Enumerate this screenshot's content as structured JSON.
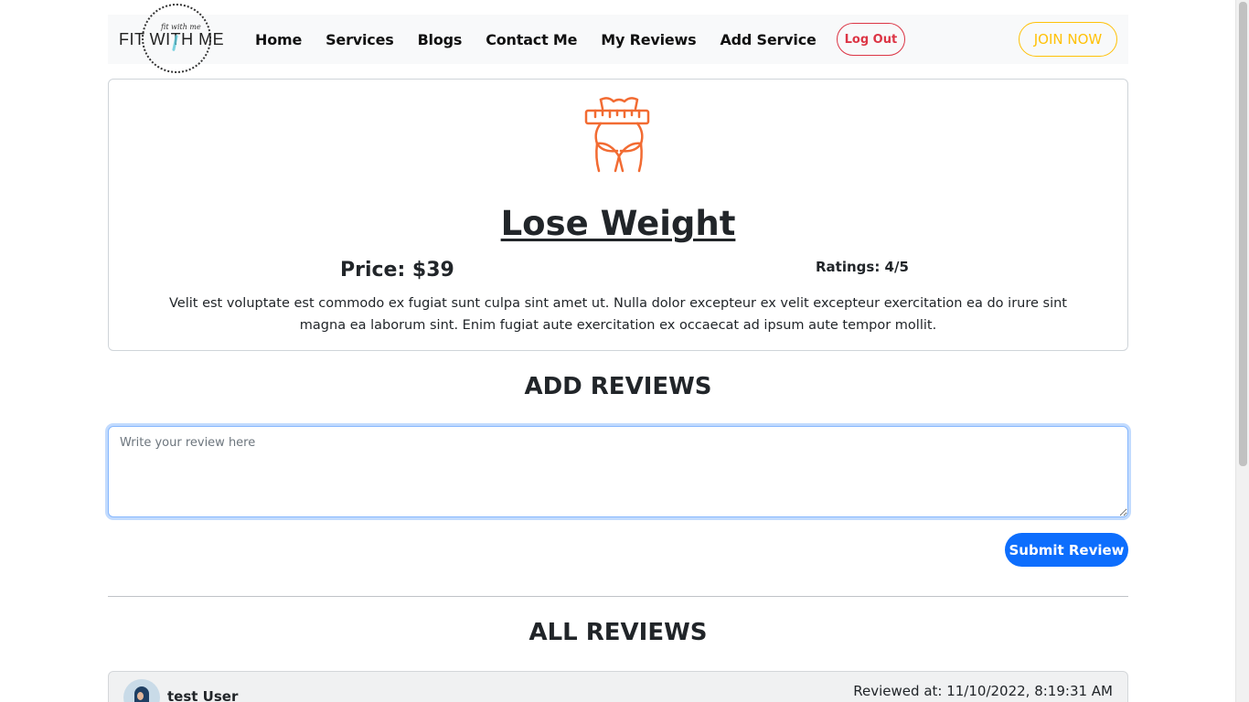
{
  "navbar": {
    "logo_small": "fit with me",
    "logo_text": "FIT WITH ME",
    "links": [
      "Home",
      "Services",
      "Blogs",
      "Contact Me",
      "My Reviews",
      "Add Service"
    ],
    "logout_label": "Log Out",
    "join_label": "JOIN NOW"
  },
  "service": {
    "icon": "weight-loss-icon",
    "icon_color": "#f26b32",
    "title": "Lose Weight",
    "price": "Price: $39",
    "ratings": "Ratings: 4/5",
    "description": "Velit est voluptate est commodo ex fugiat sunt culpa sint amet ut. Nulla dolor excepteur ex velit excepteur exercitation ea do irure sint magna ea laborum sint. Enim fugiat aute exercitation ex occaecat ad ipsum aute tempor mollit."
  },
  "add_reviews": {
    "heading": "ADD REVIEWS",
    "placeholder": "Write your review here",
    "value": "",
    "submit_label": "Submit Review"
  },
  "all_reviews": {
    "heading": "ALL REVIEWS",
    "items": [
      {
        "user": "test User",
        "date": "Reviewed at: 11/10/2022, 8:19:31 AM"
      }
    ]
  },
  "colors": {
    "primary": "#0d6efd",
    "danger": "#dc3545",
    "warning": "#ffc107",
    "accent": "#f26b32"
  }
}
